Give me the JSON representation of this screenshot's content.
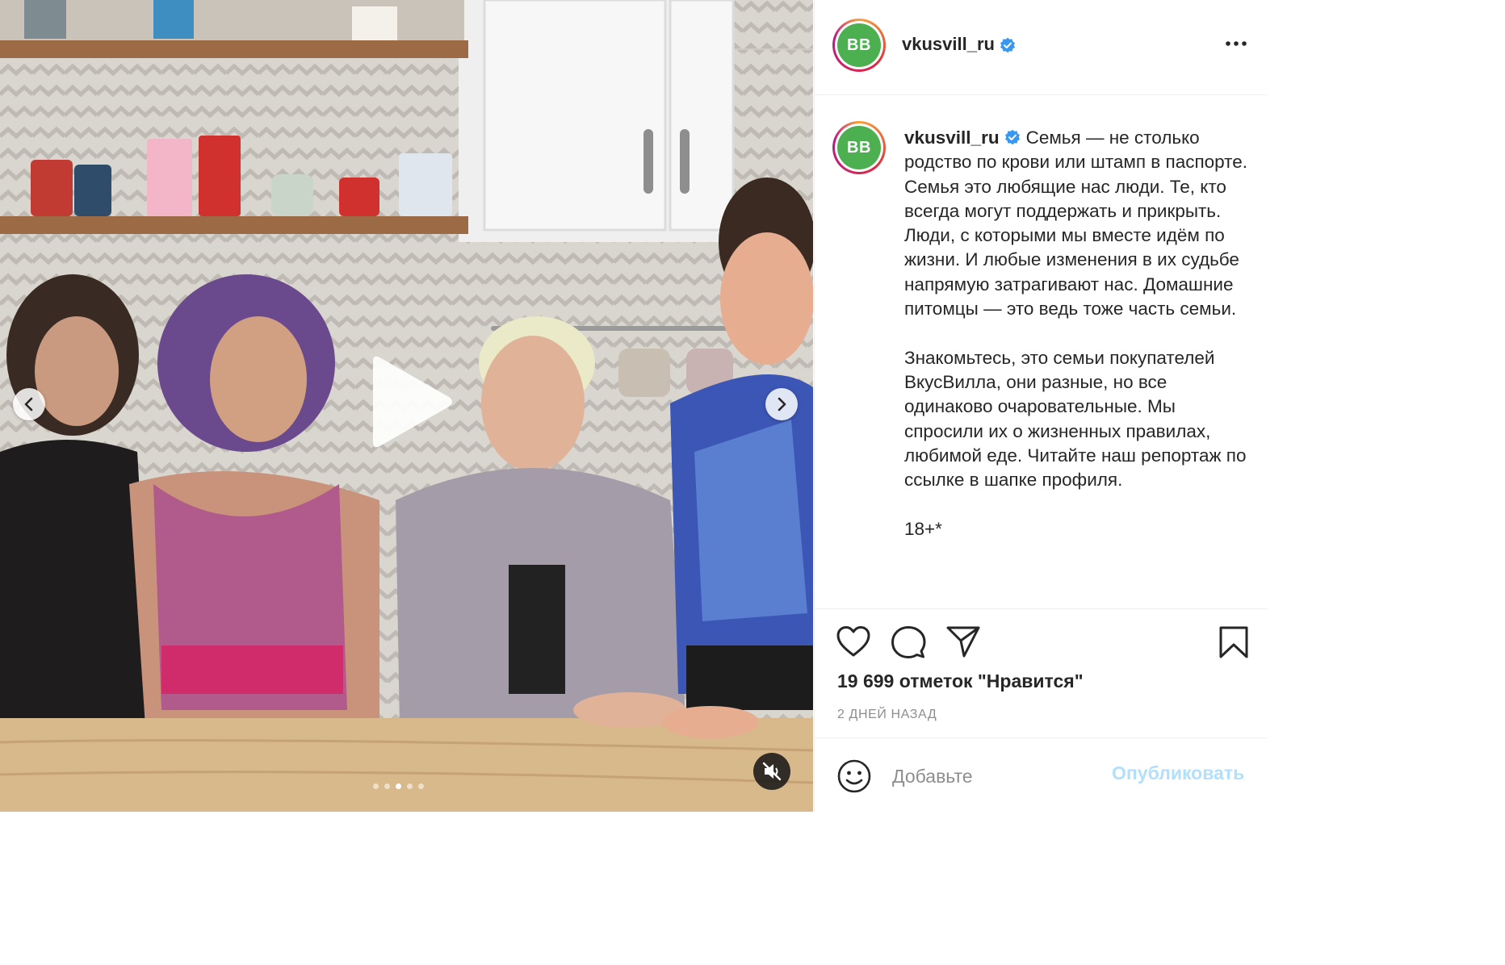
{
  "post": {
    "username": "vkusvill_ru",
    "avatar_text": "ВВ",
    "verified_icon": "verified-badge-icon",
    "more_icon": "more-options-icon"
  },
  "caption": {
    "username": "vkusvill_ru",
    "text": "Семья — не столько родство по крови или штамп в паспорте. Семья это любящие нас люди. Те, кто всегда могут поддержать и прикрыть. Люди, с которыми мы вместе идём по жизни. И любые изменения в их судьбе напрямую затрагивают нас. Домашние питомцы — это ведь тоже часть семьи.\n\nЗнакомьтесь, это семьи покупателей ВкусВилла, они разные, но все одинаково очаровательные. Мы спросили их о жизненных правилах, любимой еде. Читайте наш репортаж по ссылке в шапке профиля.\n\n18+*"
  },
  "media": {
    "type": "video",
    "play_icon": "play-icon",
    "prev_icon": "chevron-left-icon",
    "next_icon": "chevron-right-icon",
    "mute_icon": "speaker-muted-icon",
    "carousel_count": 5,
    "carousel_active": 2
  },
  "actions": {
    "like_icon": "heart-icon",
    "comment_icon": "comment-icon",
    "share_icon": "paper-plane-icon",
    "save_icon": "bookmark-icon"
  },
  "likes": "19 699 отметок \"Нравится\"",
  "timestamp": "2 ДНЕЙ НАЗАД",
  "comment": {
    "emoji_icon": "smiley-icon",
    "placeholder": "Добавьте",
    "post_label": "Опубликовать"
  },
  "colors": {
    "avatar_bg": "#4caf50",
    "verified": "#3897f0",
    "post_disabled": "#b2dffc",
    "muted_text": "#8e8e8e"
  }
}
